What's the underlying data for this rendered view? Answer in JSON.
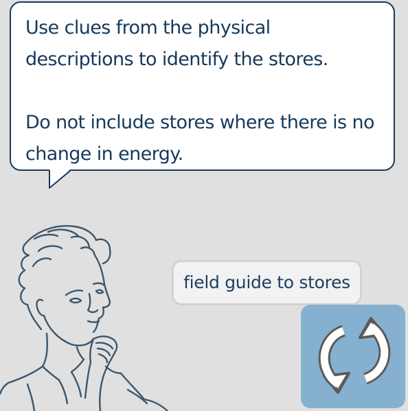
{
  "speech_bubble": {
    "line1": "Use clues from the physical descriptions to identify the stores.",
    "line2": "Do not include stores where there is no change in energy."
  },
  "buttons": {
    "field_guide_label": "field guide to stores",
    "refresh_icon": "refresh-icon"
  },
  "colors": {
    "background": "#e0e0e0",
    "text": "#16395b",
    "refresh_button": "#86b0cf",
    "guide_button": "#f2f2f2"
  }
}
